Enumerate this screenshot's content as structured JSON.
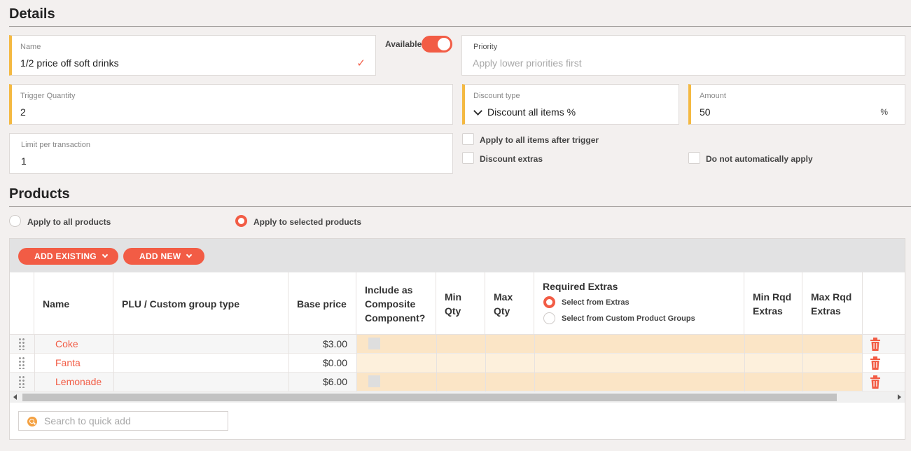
{
  "details": {
    "title": "Details",
    "name": {
      "label": "Name",
      "value": "1/2 price off soft drinks"
    },
    "available": {
      "label": "Available",
      "on": true
    },
    "priority": {
      "label": "Priority",
      "placeholder": "Apply lower priorities first"
    },
    "trigger_quantity": {
      "label": "Trigger Quantity",
      "value": "2"
    },
    "discount_type": {
      "label": "Discount type",
      "value": "Discount all items %"
    },
    "amount": {
      "label": "Amount",
      "value": "50",
      "unit": "%"
    },
    "limit": {
      "label": "Limit per transaction",
      "value": "1"
    },
    "apply_all_after_trigger": {
      "label": "Apply to all items after trigger",
      "checked": false
    },
    "discount_extras": {
      "label": "Discount extras",
      "checked": false
    },
    "do_not_auto_apply": {
      "label": "Do not automatically apply",
      "checked": false
    }
  },
  "products": {
    "title": "Products",
    "scope_all": {
      "label": "Apply to all products",
      "selected": false
    },
    "scope_selected": {
      "label": "Apply to selected products",
      "selected": true
    },
    "add_existing": "ADD EXISTING",
    "add_new": "ADD NEW",
    "columns": {
      "name": "Name",
      "plu": "PLU / Custom group type",
      "base_price": "Base price",
      "composite": "Include as Composite Component?",
      "min_qty": "Min Qty",
      "max_qty": "Max Qty",
      "required_extras": "Required Extras",
      "min_rqd": "Min Rqd Extras",
      "max_rqd": "Max Rqd Extras"
    },
    "required_extras_options": {
      "from_extras": {
        "label": "Select from Extras",
        "selected": true
      },
      "from_groups": {
        "label": "Select from Custom Product Groups",
        "selected": false
      }
    },
    "rows": [
      {
        "name": "Coke",
        "plu": "",
        "price": "$3.00"
      },
      {
        "name": "Fanta",
        "plu": "",
        "price": "$0.00"
      },
      {
        "name": "Lemonade",
        "plu": "",
        "price": "$6.00"
      }
    ],
    "quick_add_placeholder": "Search to quick add"
  },
  "colors": {
    "accent": "#f25c45",
    "required_marker": "#f4b942",
    "row_highlight": "#fbe5c6",
    "row_highlight_alt": "#fdf0dc"
  }
}
